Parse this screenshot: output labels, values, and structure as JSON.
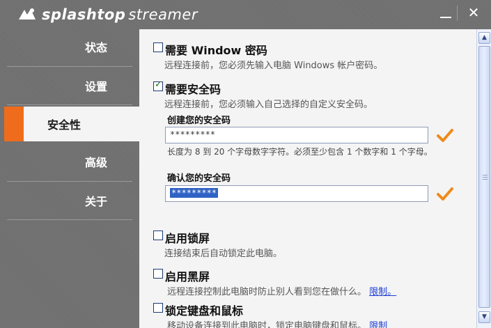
{
  "app": {
    "brand_part1": "splashtop",
    "brand_part2": "streamer",
    "minimize_label": "",
    "close_label": "✕"
  },
  "sidebar": {
    "items": [
      {
        "label": "状态"
      },
      {
        "label": "设置"
      },
      {
        "label": "安全性"
      },
      {
        "label": "高级"
      },
      {
        "label": "关于"
      }
    ],
    "active_index": 2,
    "accent_color": "#ef6c1c"
  },
  "security": {
    "windows_password": {
      "checked": false,
      "title": "需要 Window 密码",
      "desc": "远程连接前，您必须先输入电脑 Windows 帐户密码。"
    },
    "security_code": {
      "checked": true,
      "title": "需要安全码",
      "desc": "远程连接前，您必须输入自己选择的自定义安全码。",
      "create_label": "创建您的安全码",
      "create_value": "*********",
      "hint": "长度为 8 到 20 个字母数字字符。必须至少包含 1 个数字和 1 个字母。",
      "confirm_label": "确认您的安全码",
      "confirm_value": "*********"
    },
    "lock_screen": {
      "checked": false,
      "title": "启用锁屏",
      "desc": "连接结束后自动锁定此电脑。"
    },
    "black_screen": {
      "checked": false,
      "title": "启用黑屏",
      "desc": "远程连接控制此电脑时防止别人看到您在做什么。",
      "link": "限制。"
    },
    "lock_keyboard": {
      "checked": false,
      "title": "锁定键盘和鼠标",
      "desc": "移动设备连接到此电脑时，锁定电脑键盘和鼠标。",
      "link": "限制"
    }
  }
}
